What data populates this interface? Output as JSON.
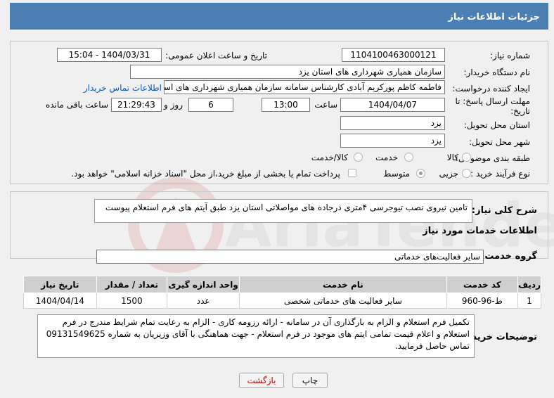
{
  "header": {
    "title": "جزئیات اطلاعات نیاز"
  },
  "form": {
    "need_number_label": "شماره نیاز:",
    "need_number": "1104100463000121",
    "announce_label": "تاریخ و ساعت اعلان عمومی:",
    "announce_value": "1404/03/31 - 15:04",
    "buyer_org_label": "نام دستگاه خریدار:",
    "buyer_org": "سازمان همیاری شهرداری های استان یزد",
    "creator_label": "ایجاد کننده درخواست:",
    "creator": "فاطمه کاظم پورکریم آبادی کارشناس سامانه سازمان همیاری شهرداری های استان",
    "contact_link": "اطلاعات تماس خریدار",
    "deadline_label_1": "مهلت ارسال پاسخ: تا",
    "deadline_label_2": "تاریخ:",
    "deadline_date": "1404/04/07",
    "time_label": "ساعت",
    "deadline_time": "13:00",
    "days_value": "6",
    "days_label": "روز و",
    "remaining_time": "21:29:43",
    "remaining_label": "ساعت باقی مانده",
    "province_label": "استان محل تحویل:",
    "province": "یزد",
    "city_label": "شهر محل تحویل:",
    "city": "یزد",
    "category_label": "طبقه بندی موضوعی:",
    "category_options": [
      "کالا",
      "خدمت",
      "کالا/خدمت"
    ],
    "process_label": "نوع فرآیند خرید :",
    "process_options": [
      "جزیی",
      "متوسط"
    ],
    "payment_note": "پرداخت تمام یا بخشی از مبلغ خرید،از محل \"اسناد خزانه اسلامی\" خواهد بود."
  },
  "summary": {
    "label": "شرح کلی نیاز:",
    "text": "تامین نیروی نصب تیوجرسی ۴متری درجاده های مواصلاتی استان یزد طبق آیتم های فرم استعلام پیوست"
  },
  "services": {
    "section_title": "اطلاعات خدمات مورد نیاز",
    "group_label": "گروه خدمت:",
    "group_value": "سایر فعالیت‌های خدماتی",
    "columns": [
      "ردیف",
      "کد خدمت",
      "نام خدمت",
      "واحد اندازه گیری",
      "تعداد / مقدار",
      "تاریخ نیاز"
    ],
    "rows": [
      {
        "row": "1",
        "code": "ط-96-960",
        "name": "سایر فعالیت های خدماتی شخصی",
        "unit": "عدد",
        "qty": "1500",
        "date": "1404/04/14"
      }
    ]
  },
  "notes": {
    "label": "توضیحات خریدار:",
    "text": "تکمیل فرم استعلام و الزام به بارگذاری آن در سامانه - ارائه رزومه کاری - الزام به رعایت تمام شرایط مندرج در فرم استعلام و اعلام قیمت تمامی ایتم های موجود در فرم استعلام - جهت هماهنگی با آقای وزیریان به شماره 09131549625 تماس حاصل فرمایید."
  },
  "buttons": {
    "print": "چاپ",
    "back": "بازگشت"
  },
  "watermark": {
    "text": "AriaTender.net"
  }
}
